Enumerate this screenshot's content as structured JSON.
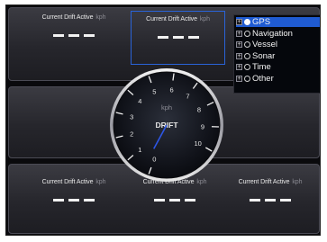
{
  "unit": "kph",
  "tiles": [
    {
      "label": "Current Drift Active",
      "unit": "kph",
      "value": "---"
    },
    {
      "label": "Current Drift Active",
      "unit": "kph",
      "value": "---"
    },
    {
      "label": "Current Drift Active",
      "unit": "kph",
      "value": "---"
    },
    {
      "label": "Current Drift Active",
      "unit": "kph",
      "value": "---"
    },
    {
      "label": "Current Drift Active",
      "unit": "kph",
      "value": "---"
    }
  ],
  "gauge": {
    "title": "DRIFT",
    "unit": "kph",
    "ticks": [
      "0",
      "1",
      "2",
      "3",
      "4",
      "5",
      "6",
      "7",
      "8",
      "9",
      "10"
    ],
    "needle_value": 0.3,
    "max": 10
  },
  "menu": {
    "items": [
      {
        "label": "GPS",
        "selected": true
      },
      {
        "label": "Navigation",
        "selected": false
      },
      {
        "label": "Vessel",
        "selected": false
      },
      {
        "label": "Sonar",
        "selected": false
      },
      {
        "label": "Time",
        "selected": false
      },
      {
        "label": "Other",
        "selected": false
      }
    ]
  },
  "colors": {
    "accent": "#1f5bd2",
    "needle": "#2d56e6"
  }
}
